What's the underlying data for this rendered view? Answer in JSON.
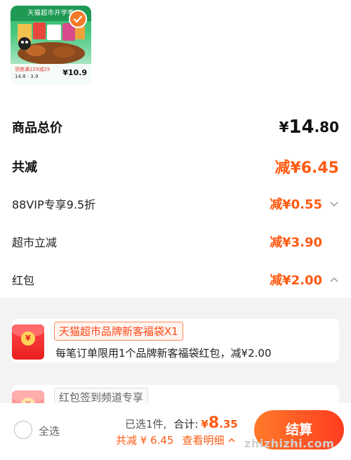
{
  "product": {
    "banner_text": "天猫超市开学季",
    "promo_text": "领券满129减25",
    "price_left": "14.8",
    "price_mid": "3.9",
    "price_right": "10.9",
    "selected": true
  },
  "summary": {
    "total_price_label": "商品总价",
    "total_price_yen": "¥",
    "total_price_int": "14",
    "total_price_dec": ".80",
    "total_reduce_label": "共减",
    "total_reduce_value": "减¥6.45"
  },
  "discounts": [
    {
      "label": "88VIP专享9.5折",
      "value": "减¥0.55",
      "has_chevron": true,
      "chevron": "chevron-down"
    },
    {
      "label": "超市立减",
      "value": "减¥3.90",
      "has_chevron": false
    },
    {
      "label": "红包",
      "value": "减¥2.00",
      "has_chevron": true,
      "chevron": "chevron-up"
    }
  ],
  "coupons": [
    {
      "tag": "天猫超市品牌新客福袋X1",
      "desc": "每笔订单限用1个品牌新客福袋红包，减¥2.00"
    },
    {
      "tag": "红包签到频道专享"
    }
  ],
  "bottom_bar": {
    "select_all_label": "全选",
    "selected_count": "已选1件,",
    "total_label": "合计:",
    "total_yen": "¥",
    "total_int": "8",
    "total_dec": ".35",
    "reduce_text": "共减 ¥ 6.45",
    "detail_label": "查看明细",
    "checkout_label": "结算"
  },
  "watermark": "zhizhizhi.com",
  "colors": {
    "accent": "#ff5a12",
    "check": "#f47a2a",
    "coupon_red": "#e81f1f"
  }
}
